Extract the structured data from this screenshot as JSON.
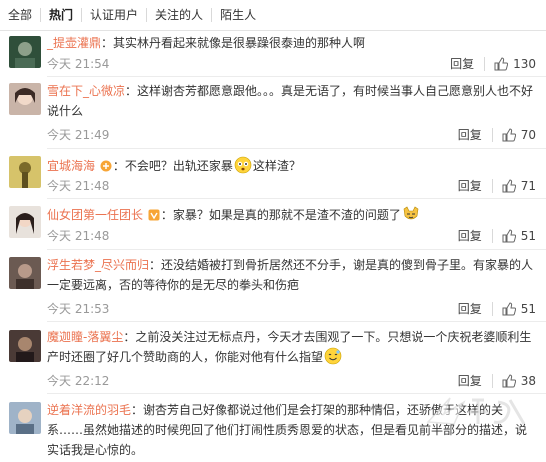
{
  "tabs": [
    "全部",
    "热门",
    "认证用户",
    "关注的人",
    "陌生人"
  ],
  "reply_label": "回复",
  "comments": [
    {
      "user": "_提壶灌鼎",
      "text": "：其实林丹看起来就像是很暴躁很泰迪的那种人啊",
      "time": "今天 21:54",
      "likes": "130"
    },
    {
      "user": "雪在下_心微凉",
      "text": "：这样谢杏芳都愿意跟他。。。真是无语了，有时候当事人自己愿意别人也不好说什么",
      "time": "今天 21:49",
      "likes": "70"
    },
    {
      "user": "宜城海海",
      "text_a": "：不会吧？出轨还家暴",
      "text_b": "这样渣？",
      "time": "今天 21:48",
      "likes": "71"
    },
    {
      "user": "仙女团第一任团长",
      "text": "：家暴？如果是真的那就不是渣不渣的问题了",
      "time": "今天 21:48",
      "likes": "51"
    },
    {
      "user": "浮生若梦_尽兴而归",
      "text": "：还没结婚被打到骨折居然还不分手，谢是真的傻到骨子里。有家暴的人一定要远离，否的等待你的是无尽的拳头和伤疤",
      "time": "今天 21:53",
      "likes": "51"
    },
    {
      "user": "魔迦瞳-落翼尘",
      "text": "：之前没关注过无标点丹，今天才去围观了一下。只想说一个庆祝老婆顺利生产时还圈了好几个赞助商的人，你能对他有什么指望",
      "time": "今天 22:12",
      "likes": "38"
    },
    {
      "user": "逆着洋流的羽毛",
      "text": "：谢杏芳自己好像都说过他们是会打架的那种情侣，还骄傲于这样的关系……虽然她描述的时候兜回了他们打闹性质秀恩爱的状态，但是看见前半部分的描述，说实话我是心惊的。",
      "time": "",
      "likes": ""
    }
  ],
  "icons": {
    "like": "thumbs-up-icon",
    "vip": "vip-badge-icon",
    "fan": "fan-badge-icon",
    "emoji": "emoji-icon"
  },
  "colors": {
    "username": "#eb7350",
    "time": "#999999",
    "text": "#333333"
  }
}
